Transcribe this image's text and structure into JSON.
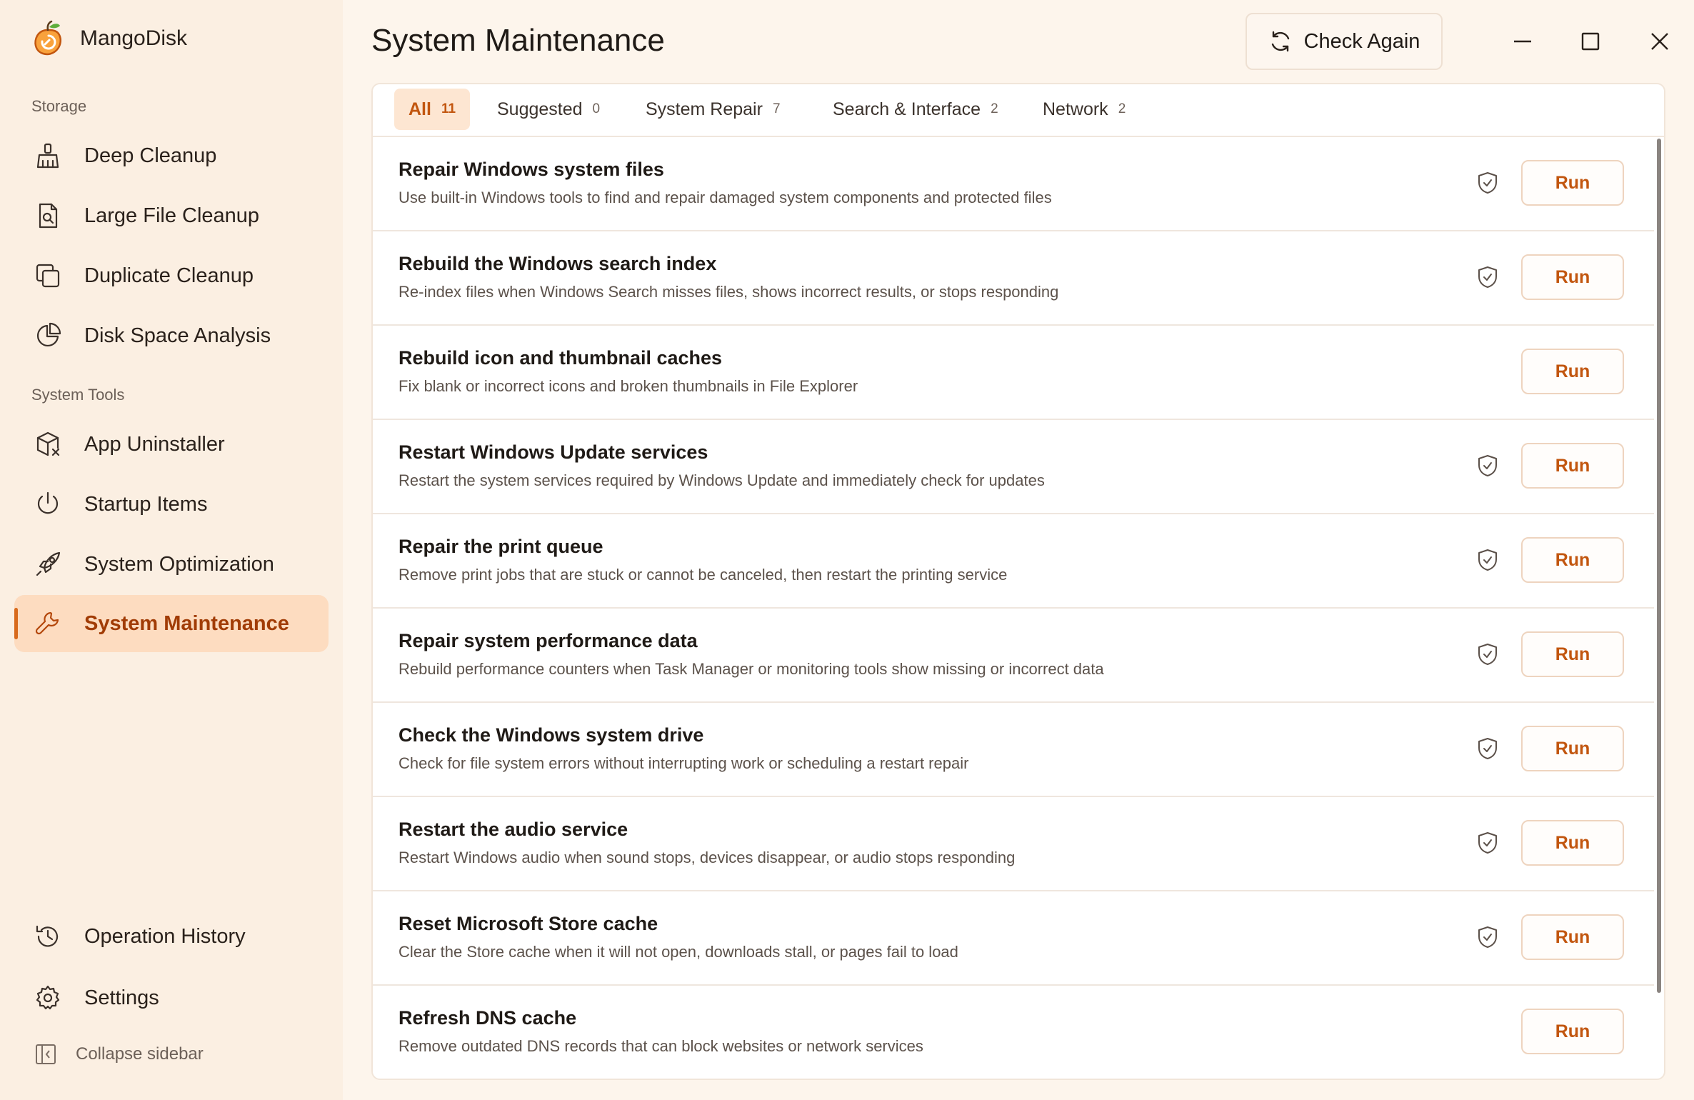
{
  "app": {
    "name": "MangoDisk"
  },
  "sidebar": {
    "sections": [
      {
        "label": "Storage"
      },
      {
        "label": "System Tools"
      }
    ],
    "items": [
      {
        "label": "Deep Cleanup",
        "icon": "broom-icon"
      },
      {
        "label": "Large File Cleanup",
        "icon": "file-search-icon"
      },
      {
        "label": "Duplicate Cleanup",
        "icon": "copy-icon"
      },
      {
        "label": "Disk Space Analysis",
        "icon": "pie-chart-icon"
      },
      {
        "label": "App Uninstaller",
        "icon": "package-remove-icon"
      },
      {
        "label": "Startup Items",
        "icon": "power-icon"
      },
      {
        "label": "System Optimization",
        "icon": "rocket-icon"
      },
      {
        "label": "System Maintenance",
        "icon": "wrench-icon",
        "active": true
      }
    ],
    "bottom": [
      {
        "label": "Operation History",
        "icon": "history-icon"
      },
      {
        "label": "Settings",
        "icon": "gear-icon"
      }
    ],
    "collapse_label": "Collapse sidebar"
  },
  "header": {
    "title": "System Maintenance",
    "check_again_label": "Check Again"
  },
  "tabs": [
    {
      "label": "All",
      "count": "11",
      "active": true
    },
    {
      "label": "Suggested",
      "count": "0"
    },
    {
      "label": "System Repair",
      "count": "7"
    },
    {
      "label": "Search & Interface",
      "count": "2"
    },
    {
      "label": "Network",
      "count": "2"
    }
  ],
  "tasks": [
    {
      "title": "Repair Windows system files",
      "desc": "Use built-in Windows tools to find and repair damaged system components and protected files",
      "admin": true,
      "action": "Run"
    },
    {
      "title": "Rebuild the Windows search index",
      "desc": "Re-index files when Windows Search misses files, shows incorrect results, or stops responding",
      "admin": true,
      "action": "Run"
    },
    {
      "title": "Rebuild icon and thumbnail caches",
      "desc": "Fix blank or incorrect icons and broken thumbnails in File Explorer",
      "admin": false,
      "action": "Run"
    },
    {
      "title": "Restart Windows Update services",
      "desc": "Restart the system services required by Windows Update and immediately check for updates",
      "admin": true,
      "action": "Run"
    },
    {
      "title": "Repair the print queue",
      "desc": "Remove print jobs that are stuck or cannot be canceled, then restart the printing service",
      "admin": true,
      "action": "Run"
    },
    {
      "title": "Repair system performance data",
      "desc": "Rebuild performance counters when Task Manager or monitoring tools show missing or incorrect data",
      "admin": true,
      "action": "Run"
    },
    {
      "title": "Check the Windows system drive",
      "desc": "Check for file system errors without interrupting work or scheduling a restart repair",
      "admin": true,
      "action": "Run"
    },
    {
      "title": "Restart the audio service",
      "desc": "Restart Windows audio when sound stops, devices disappear, or audio stops responding",
      "admin": true,
      "action": "Run"
    },
    {
      "title": "Reset Microsoft Store cache",
      "desc": "Clear the Store cache when it will not open, downloads stall, or pages fail to load",
      "admin": true,
      "action": "Run"
    },
    {
      "title": "Refresh DNS cache",
      "desc": "Remove outdated DNS records that can block websites or network services",
      "admin": false,
      "action": "Run"
    }
  ],
  "colors": {
    "accent": "#c2560f",
    "active_bg": "#fddcc0",
    "sidebar_bg": "#fbefe2"
  }
}
